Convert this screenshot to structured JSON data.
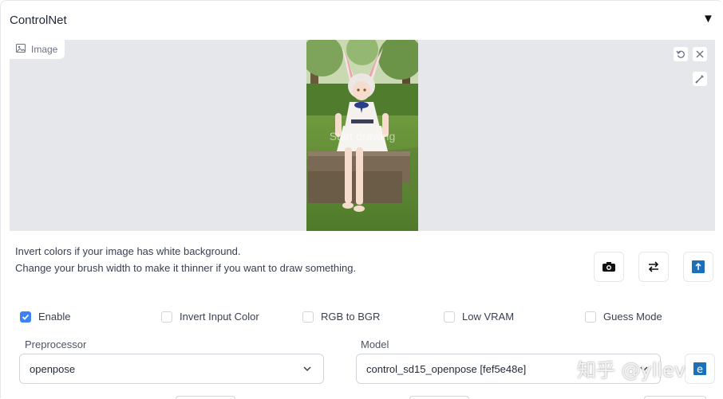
{
  "panel": {
    "title": "ControlNet",
    "collapse_icon": "triangle-down-icon"
  },
  "image": {
    "label": "Image",
    "label_icon": "image-icon",
    "overlay_text": "Start drawing",
    "tools": [
      "undo-icon",
      "close-icon",
      "brush-icon"
    ]
  },
  "hints": {
    "line1": "Invert colors if your image has white background.",
    "line2": "Change your brush width to make it thinner if you want to draw something."
  },
  "actions": [
    "camera-icon",
    "swap-icon",
    "upload-icon"
  ],
  "checkboxes": [
    {
      "label": "Enable",
      "checked": true
    },
    {
      "label": "Invert Input Color",
      "checked": false
    },
    {
      "label": "RGB to BGR",
      "checked": false
    },
    {
      "label": "Low VRAM",
      "checked": false
    },
    {
      "label": "Guess Mode",
      "checked": false
    }
  ],
  "preprocessor": {
    "label": "Preprocessor",
    "value": "openpose"
  },
  "model": {
    "label": "Model",
    "value": "control_sd15_openpose [fef5e48e]"
  },
  "watermark": "知乎 @yllev",
  "colors": {
    "accent": "#3b82f6",
    "canvas_bg": "#e5e7eb"
  }
}
